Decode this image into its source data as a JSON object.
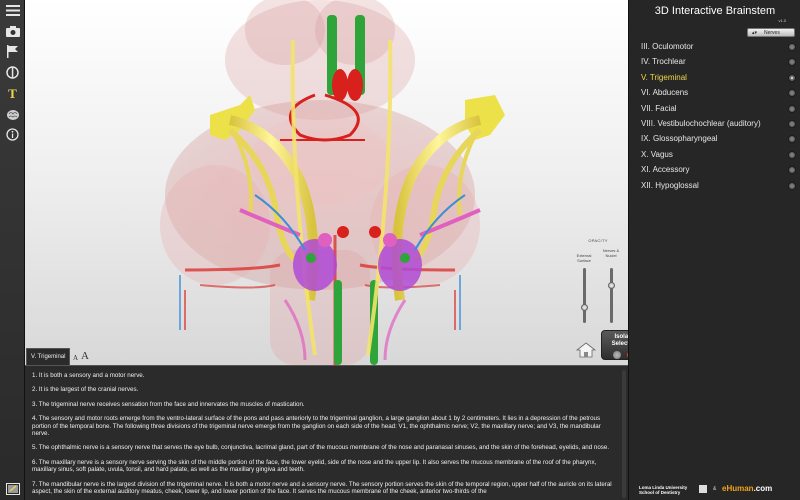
{
  "app": {
    "title": "3D Interactive Brainstem",
    "version": "v1.0"
  },
  "toolbar": {
    "items": [
      {
        "icon": "menu-icon"
      },
      {
        "icon": "camera-icon"
      },
      {
        "icon": "flag-icon"
      },
      {
        "icon": "opacity-icon"
      },
      {
        "icon": "text-icon"
      },
      {
        "icon": "brain-icon"
      },
      {
        "icon": "info-icon"
      }
    ],
    "bottom_icon": "window-icon"
  },
  "nerve_filter": {
    "selected": "Nerves"
  },
  "nerves": [
    {
      "label": "III. Oculomotor",
      "selected": false
    },
    {
      "label": "IV. Trochlear",
      "selected": false
    },
    {
      "label": "V. Trigeminal",
      "selected": true
    },
    {
      "label": "VI. Abducens",
      "selected": false
    },
    {
      "label": "VII. Facial",
      "selected": false
    },
    {
      "label": "VIII. Vestibulochochlear (auditory)",
      "selected": false
    },
    {
      "label": "IX. Glossopharyngeal",
      "selected": false
    },
    {
      "label": "X. Vagus",
      "selected": false
    },
    {
      "label": "XI. Accessory",
      "selected": false
    },
    {
      "label": "XII. Hypoglossal",
      "selected": false
    }
  ],
  "opacity": {
    "title": "OPACITY",
    "external_label": "External Surface",
    "nerves_label": "Nerves & Nuclei",
    "external_level": 0.3,
    "nerves_level": 0.7
  },
  "isolate": {
    "label": "Isolate Selected",
    "colors": [
      "#777777",
      "#d8201c"
    ]
  },
  "info": {
    "tab_label": "V. Trigeminal",
    "font_small": "A",
    "font_large": "A",
    "paragraphs": [
      "1.  It is both a sensory and a motor nerve.",
      "2.  It is the largest of the cranial nerves.",
      "3.  The trigeminal nerve receives sensation from the face and innervates the muscles of mastication.",
      "4.  The sensory and motor roots emerge from the ventro-lateral surface of the pons and pass anteriorly to the trigeminal ganglion, a large ganglion about 1 by 2 centimeters.  It lies in a depression of the petrous portion of the temporal bone.  The following three divisions of the trigeminal nerve emerge from the ganglion on each side of the head: V1, the ophthalmic nerve; V2, the maxillary nerve; and V3, the mandibular nerve.",
      "5.  The ophthalmic nerve is a sensory nerve that serves the eye bulb, conjunctiva, lacrimal gland, part of the mucous membrane of the nose and paranasal sinuses, and the skin of the forehead, eyelids, and nose.",
      "6.  The maxillary nerve is a sensory nerve serving the skin of the middle portion of the face, the lower eyelid, side of the nose and the upper lip.  It also serves the mucous membrane of the roof of the pharynx, maxillary sinus, soft palate, uvula, tonsil, and hard palate, as well as the maxillary gingiva and teeth.",
      "7.  The mandibular nerve is the largest division of the trigeminal nerve.  It is both a motor nerve and a sensory nerve.  The sensory portion serves the skin of the temporal region, upper half of the auricle on its lateral aspect, the skin of the external auditory meatus, cheek, lower lip, and lower portion of the face.  It serves the mucous membrane of the cheek, anterior two-thirds of the"
    ]
  },
  "footer": {
    "llu_line1": "Loma Linda University",
    "llu_line2": "School of Dentistry",
    "ampersand": "&",
    "ehuman_main": "eHuman",
    "ehuman_tail": ".com"
  },
  "colors": {
    "trigeminal": "#f3e36b",
    "trigeminal_highlight": "#ede14a",
    "oculomotor": "#2ea43a",
    "vessels": "#d8201c",
    "nuclei": "#b04ad6",
    "hypoglossal_pink": "#e060c0",
    "blue_nerve": "#3a8fd6",
    "selected_text": "#f0d84a"
  }
}
